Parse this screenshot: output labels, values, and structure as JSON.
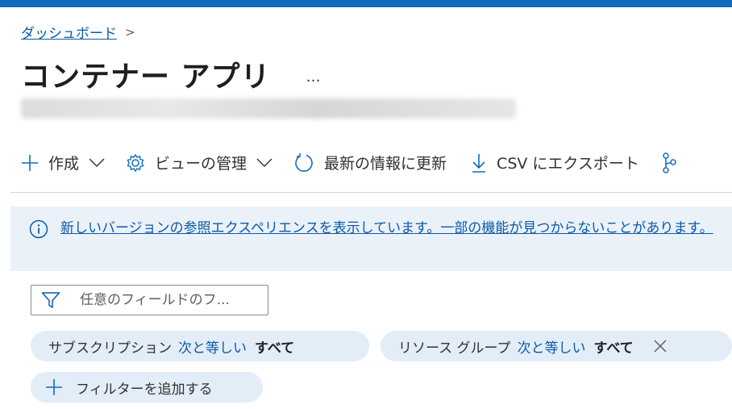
{
  "breadcrumb": {
    "link": "ダッシュボード",
    "separator": ">"
  },
  "page": {
    "title": "コンテナー アプリ",
    "more": "…"
  },
  "toolbar": {
    "create": "作成",
    "manage_view": "ビューの管理",
    "refresh": "最新の情報に更新",
    "export_csv": "CSV にエクスポート"
  },
  "banner": {
    "message": "新しいバージョンの参照エクスペリエンスを表示しています。一部の機能が見つからないことがあります。"
  },
  "filter": {
    "placeholder": "任意のフィールドのフ..."
  },
  "pills": {
    "subscription": {
      "field": "サブスクリプション",
      "operator": "次と等しい",
      "value": "すべて"
    },
    "resource_group": {
      "field": "リソース グループ",
      "operator": "次と等しい",
      "value": "すべて"
    },
    "add_filter": "フィルターを追加する"
  },
  "colors": {
    "accent": "#0f6cbd",
    "link": "#0b5aa8",
    "banner_bg": "#eaf1f9",
    "pill_bg": "#e3edf8"
  },
  "icons": [
    "plus-icon",
    "chevron-down-icon",
    "gear-icon",
    "refresh-icon",
    "download-icon",
    "branch-icon",
    "info-icon",
    "filter-icon",
    "close-icon"
  ]
}
